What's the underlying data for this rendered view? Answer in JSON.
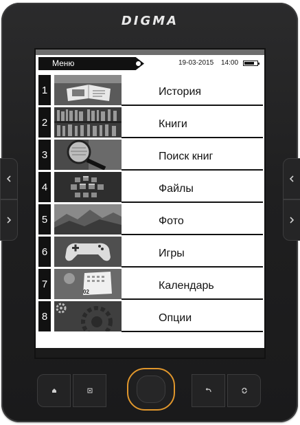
{
  "device": {
    "brand": "DIGMA",
    "accent": "#e1972c"
  },
  "status": {
    "menu_title": "Меню",
    "date": "19-03-2015",
    "time": "14:00",
    "battery_level": 0.8
  },
  "menu": [
    {
      "number": "1",
      "label": "История",
      "thumb": "open-book-photo"
    },
    {
      "number": "2",
      "label": "Книги",
      "thumb": "bookshelf-photo"
    },
    {
      "number": "3",
      "label": "Поиск книг",
      "thumb": "magnifier-photo"
    },
    {
      "number": "4",
      "label": "Файлы",
      "thumb": "cubes-photo"
    },
    {
      "number": "5",
      "label": "Фото",
      "thumb": "mountains-photo"
    },
    {
      "number": "6",
      "label": "Игры",
      "thumb": "gamepad-photo"
    },
    {
      "number": "7",
      "label": "Календарь",
      "thumb": "calendar-photo"
    },
    {
      "number": "8",
      "label": "Опции",
      "thumb": "gears-photo"
    }
  ],
  "calendar_thumb_text": "02",
  "side_buttons": {
    "left_up": "chevron-left-icon",
    "left_down": "chevron-right-icon",
    "right_up": "chevron-left-icon",
    "right_down": "chevron-right-icon"
  },
  "bottom_keys": [
    "home-icon",
    "menu-icon",
    "back-icon",
    "rotate-icon"
  ]
}
